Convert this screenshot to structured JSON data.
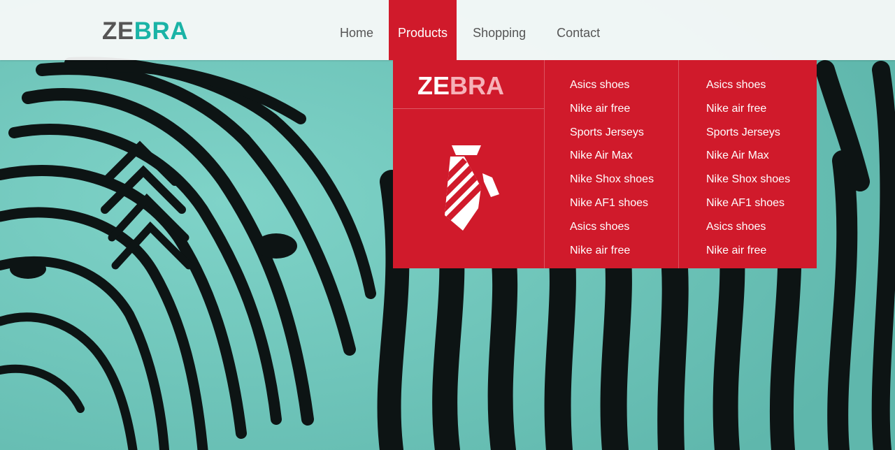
{
  "brand": {
    "part1": "ZE",
    "part2": "BRA"
  },
  "nav": {
    "items": [
      {
        "label": "Home"
      },
      {
        "label": "Products"
      },
      {
        "label": "Shopping"
      },
      {
        "label": "Contact"
      }
    ],
    "active": "Products"
  },
  "megamenu": {
    "brand": {
      "part1": "ZE",
      "part2": "BRA"
    },
    "icon": "necktie-icon",
    "column1": [
      "Asics shoes",
      "Nike air free",
      "Sports Jerseys",
      "Nike Air Max",
      "Nike Shox shoes",
      "Nike AF1 shoes",
      "Asics shoes",
      "Nike air free"
    ],
    "column2": [
      "Asics shoes",
      "Nike air free",
      "Sports Jerseys",
      "Nike Air Max",
      "Nike Shox shoes",
      "Nike AF1 shoes",
      "Asics shoes",
      "Nike air free"
    ]
  },
  "colors": {
    "accent_red": "#d01a2b",
    "logo_teal": "#1ab3a6",
    "logo_gray": "#555555",
    "header_bg": "#fafafa",
    "hero_tint": "#6fc9be"
  },
  "hero": {
    "image": "zebra-stripes"
  }
}
